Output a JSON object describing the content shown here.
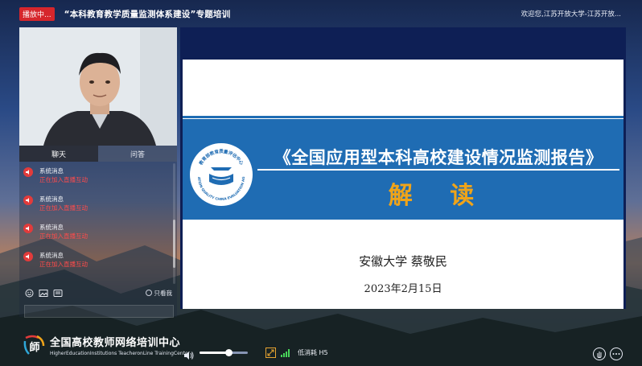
{
  "header": {
    "live_badge": "播放中...",
    "title": "“本科教育教学质量监测体系建设”专题培训",
    "welcome": "欢迎您,江苏开放大学-江苏开放..."
  },
  "chat": {
    "tabs": [
      {
        "label": "聊天",
        "active": true
      },
      {
        "label": "问答",
        "active": false
      }
    ],
    "messages": [
      {
        "sender": "系统消息",
        "body": "正在加入直播互动"
      },
      {
        "sender": "系统消息",
        "body": "正在加入直播互动"
      },
      {
        "sender": "系统消息",
        "body": "正在加入直播互动"
      },
      {
        "sender": "系统消息",
        "body": "正在加入直播互动"
      }
    ],
    "only_me_label": "只看我",
    "input_value": ""
  },
  "slide": {
    "report_title": "《全国应用型本科高校建设情况监测报告》",
    "subtitle": "解 读",
    "presenter": "安徽大学 蔡敬民",
    "date": "2023年2月15日",
    "logo_ring_text": "EDUCATION QUALITY CHINA EVALUATION AGENCY",
    "logo_cn_text": "教育部教育质量评估中心"
  },
  "brand": {
    "cn": "全国高校教师网络培训中心",
    "en": "HigherEducationInstitutions TeacheronLine TrainingCenter",
    "mark_char": "師"
  },
  "controls": {
    "volume_level": 0.6,
    "quality_label": "低消耗 H5"
  },
  "colors": {
    "live_badge": "#d6262c",
    "slide_band": "#1f6cb3",
    "subtitle": "#f0a419",
    "message_body": "#ff4b4b"
  }
}
